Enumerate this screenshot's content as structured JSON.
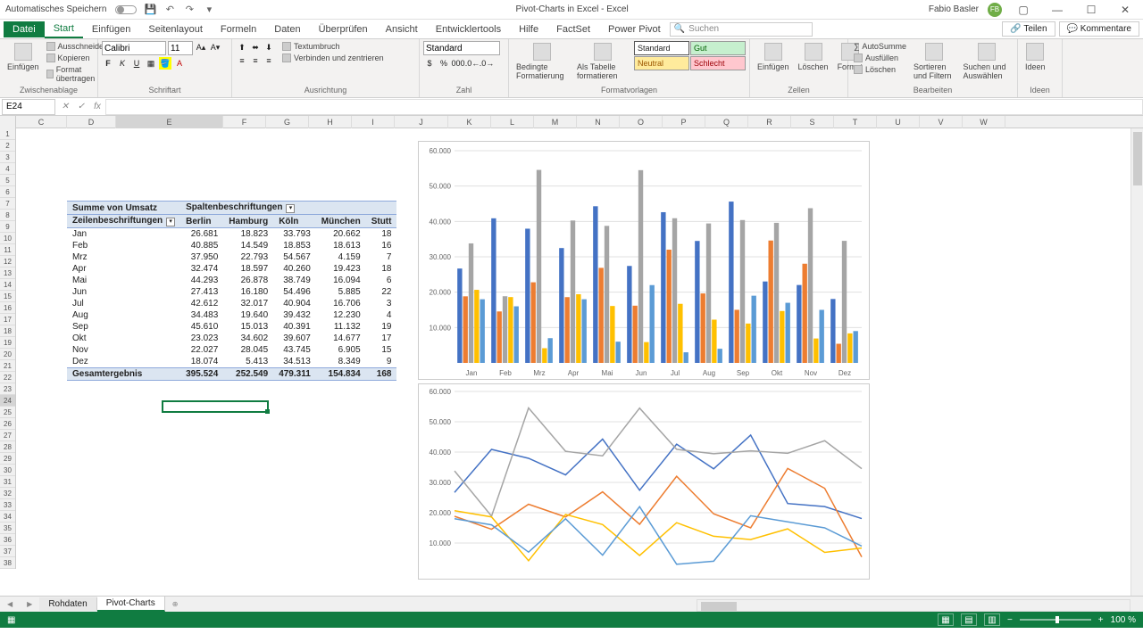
{
  "titlebar": {
    "autosave": "Automatisches Speichern",
    "title": "Pivot-Charts in Excel - Excel",
    "user": "Fabio Basler",
    "user_initials": "FB"
  },
  "tabs": {
    "file": "Datei",
    "start": "Start",
    "einfuegen": "Einfügen",
    "seitenlayout": "Seitenlayout",
    "formeln": "Formeln",
    "daten": "Daten",
    "ueberpruefen": "Überprüfen",
    "ansicht": "Ansicht",
    "entwicklertools": "Entwicklertools",
    "hilfe": "Hilfe",
    "factset": "FactSet",
    "powerpivot": "Power Pivot",
    "search_placeholder": "Suchen",
    "teilen": "Teilen",
    "kommentare": "Kommentare"
  },
  "ribbon": {
    "einfuegen": "Einfügen",
    "ausschneiden": "Ausschneiden",
    "kopieren": "Kopieren",
    "format_uebertragen": "Format übertragen",
    "zwischenablage": "Zwischenablage",
    "font_name": "Calibri",
    "font_size": "11",
    "schriftart": "Schriftart",
    "textumbruch": "Textumbruch",
    "verbinden": "Verbinden und zentrieren",
    "ausrichtung": "Ausrichtung",
    "num_format": "Standard",
    "zahl": "Zahl",
    "bedingte": "Bedingte Formatierung",
    "als_tabelle": "Als Tabelle formatieren",
    "standard": "Standard",
    "gut": "Gut",
    "neutral": "Neutral",
    "schlecht": "Schlecht",
    "formatvorlagen": "Formatvorlagen",
    "zellen_einfuegen": "Einfügen",
    "loeschen": "Löschen",
    "format": "Format",
    "zellen": "Zellen",
    "autosumme": "AutoSumme",
    "ausfuellen": "Ausfüllen",
    "leeren": "Löschen",
    "sortieren": "Sortieren und Filtern",
    "suchen": "Suchen und Auswählen",
    "bearbeiten": "Bearbeiten",
    "ideen": "Ideen"
  },
  "namebox": "E24",
  "pivot": {
    "summe": "Summe von Umsatz",
    "spalten": "Spaltenbeschriftungen",
    "zeilen": "Zeilenbeschriftungen",
    "cities": [
      "Berlin",
      "Hamburg",
      "Köln",
      "München",
      "Stutt"
    ],
    "months": [
      "Jan",
      "Feb",
      "Mrz",
      "Apr",
      "Mai",
      "Jun",
      "Jul",
      "Aug",
      "Sep",
      "Okt",
      "Nov",
      "Dez"
    ],
    "gesamt": "Gesamtergebnis",
    "rows": [
      [
        "26.681",
        "18.823",
        "33.793",
        "20.662",
        "18"
      ],
      [
        "40.885",
        "14.549",
        "18.853",
        "18.613",
        "16"
      ],
      [
        "37.950",
        "22.793",
        "54.567",
        "4.159",
        "7"
      ],
      [
        "32.474",
        "18.597",
        "40.260",
        "19.423",
        "18"
      ],
      [
        "44.293",
        "26.878",
        "38.749",
        "16.094",
        "6"
      ],
      [
        "27.413",
        "16.180",
        "54.496",
        "5.885",
        "22"
      ],
      [
        "42.612",
        "32.017",
        "40.904",
        "16.706",
        "3"
      ],
      [
        "34.483",
        "19.640",
        "39.432",
        "12.230",
        "4"
      ],
      [
        "45.610",
        "15.013",
        "40.391",
        "11.132",
        "19"
      ],
      [
        "23.023",
        "34.602",
        "39.607",
        "14.677",
        "17"
      ],
      [
        "22.027",
        "28.045",
        "43.745",
        "6.905",
        "15"
      ],
      [
        "18.074",
        "5.413",
        "34.513",
        "8.349",
        "9"
      ]
    ],
    "totals": [
      "395.524",
      "252.549",
      "479.311",
      "154.834",
      "168"
    ]
  },
  "chart_data": [
    {
      "type": "bar",
      "categories": [
        "Jan",
        "Feb",
        "Mrz",
        "Apr",
        "Mai",
        "Jun",
        "Jul",
        "Aug",
        "Sep",
        "Okt",
        "Nov",
        "Dez"
      ],
      "series": [
        {
          "name": "Berlin",
          "color": "#4472c4",
          "values": [
            26681,
            40885,
            37950,
            32474,
            44293,
            27413,
            42612,
            34483,
            45610,
            23023,
            22027,
            18074
          ]
        },
        {
          "name": "Hamburg",
          "color": "#ed7d31",
          "values": [
            18823,
            14549,
            22793,
            18597,
            26878,
            16180,
            32017,
            19640,
            15013,
            34602,
            28045,
            5413
          ]
        },
        {
          "name": "Köln",
          "color": "#a5a5a5",
          "values": [
            33793,
            18853,
            54567,
            40260,
            38749,
            54496,
            40904,
            39432,
            40391,
            39607,
            43745,
            34513
          ]
        },
        {
          "name": "München",
          "color": "#ffc000",
          "values": [
            20662,
            18613,
            4159,
            19423,
            16094,
            5885,
            16706,
            12230,
            11132,
            14677,
            6905,
            8349
          ]
        },
        {
          "name": "Stuttgart",
          "color": "#5b9bd5",
          "values": [
            18000,
            16000,
            7000,
            18000,
            6000,
            22000,
            3000,
            4000,
            19000,
            17000,
            15000,
            9000
          ]
        }
      ],
      "ylim": [
        0,
        60000
      ],
      "yticks": [
        10000,
        20000,
        30000,
        40000,
        50000,
        60000
      ],
      "ytick_labels": [
        "10.000",
        "20.000",
        "30.000",
        "40.000",
        "50.000",
        "60.000"
      ]
    },
    {
      "type": "line",
      "categories": [
        "Jan",
        "Feb",
        "Mrz",
        "Apr",
        "Mai",
        "Jun",
        "Jul",
        "Aug",
        "Sep",
        "Okt",
        "Nov",
        "Dez"
      ],
      "series": [
        {
          "name": "Berlin",
          "color": "#4472c4",
          "values": [
            26681,
            40885,
            37950,
            32474,
            44293,
            27413,
            42612,
            34483,
            45610,
            23023,
            22027,
            18074
          ]
        },
        {
          "name": "Hamburg",
          "color": "#ed7d31",
          "values": [
            18823,
            14549,
            22793,
            18597,
            26878,
            16180,
            32017,
            19640,
            15013,
            34602,
            28045,
            5413
          ]
        },
        {
          "name": "Köln",
          "color": "#a5a5a5",
          "values": [
            33793,
            18853,
            54567,
            40260,
            38749,
            54496,
            40904,
            39432,
            40391,
            39607,
            43745,
            34513
          ]
        },
        {
          "name": "München",
          "color": "#ffc000",
          "values": [
            20662,
            18613,
            4159,
            19423,
            16094,
            5885,
            16706,
            12230,
            11132,
            14677,
            6905,
            8349
          ]
        },
        {
          "name": "Stuttgart",
          "color": "#5b9bd5",
          "values": [
            18000,
            16000,
            7000,
            18000,
            6000,
            22000,
            3000,
            4000,
            19000,
            17000,
            15000,
            9000
          ]
        }
      ],
      "ylim": [
        0,
        60000
      ],
      "yticks": [
        10000,
        20000,
        30000,
        40000,
        50000,
        60000
      ],
      "ytick_labels": [
        "10.000",
        "20.000",
        "30.000",
        "40.000",
        "50.000",
        "60.000"
      ]
    }
  ],
  "sheets": {
    "rohdaten": "Rohdaten",
    "pivot": "Pivot-Charts"
  },
  "statusbar": {
    "zoom": "100 %"
  }
}
